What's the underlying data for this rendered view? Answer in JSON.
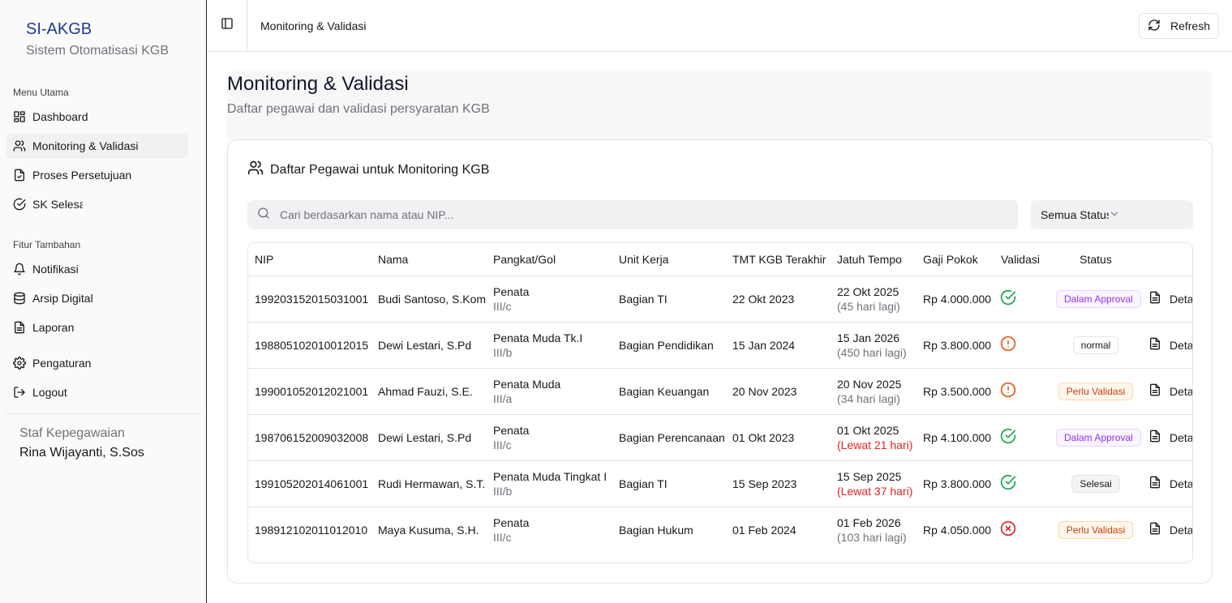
{
  "brand": {
    "title": "SI-AKGB",
    "subtitle": "Sistem Otomatisasi KGB"
  },
  "sidebar": {
    "group1_label": "Menu Utama",
    "group1": [
      {
        "label": "Dashboard",
        "icon": "dashboard-icon"
      },
      {
        "label": "Monitoring & Validasi",
        "icon": "users-icon",
        "active": true
      },
      {
        "label": "Proses Persetujuan",
        "icon": "file-check-icon"
      },
      {
        "label": "SK Selesai",
        "icon": "check-circle-icon"
      }
    ],
    "group2_label": "Fitur Tambahan",
    "group2": [
      {
        "label": "Notifikasi",
        "icon": "bell-icon"
      },
      {
        "label": "Arsip Digital",
        "icon": "database-icon"
      },
      {
        "label": "Laporan",
        "icon": "file-text-icon"
      }
    ],
    "group3": [
      {
        "label": "Pengaturan",
        "icon": "gear-icon"
      },
      {
        "label": "Logout",
        "icon": "logout-icon"
      }
    ],
    "user_role": "Staf Kepegawaian",
    "user_name": "Rina Wijayanti, S.Sos"
  },
  "topbar": {
    "title": "Monitoring & Validasi",
    "refresh_label": "Refresh"
  },
  "page": {
    "title": "Monitoring & Validasi",
    "subtitle": "Daftar pegawai dan validasi persyaratan KGB"
  },
  "card": {
    "title": "Daftar Pegawai untuk Monitoring KGB",
    "search_placeholder": "Cari berdasarkan nama atau NIP...",
    "filter_value": "Semua Status"
  },
  "table": {
    "columns": [
      "NIP",
      "Nama",
      "Pangkat/Gol",
      "Unit Kerja",
      "TMT KGB Terakhir",
      "Jatuh Tempo",
      "Gaji Pokok",
      "Validasi",
      "Status"
    ],
    "detail_label": "Detail",
    "rows": [
      {
        "nip": "199203152015031001",
        "nama": "Budi Santoso, S.Kom",
        "pangkat": "Penata",
        "gol": "III/c",
        "unit": "Bagian TI",
        "tmt": "22 Okt 2023",
        "jatuh": "22 Okt 2025",
        "sisa": "(45 hari lagi)",
        "late": false,
        "gaji": "Rp 4.000.000",
        "validasi": "valid",
        "status": "Dalam Approval"
      },
      {
        "nip": "198805102010012015",
        "nama": "Dewi Lestari, S.Pd",
        "pangkat": "Penata Muda Tk.I",
        "gol": "III/b",
        "unit": "Bagian Pendidikan",
        "tmt": "15 Jan 2024",
        "jatuh": "15 Jan 2026",
        "sisa": "(450 hari lagi)",
        "late": false,
        "gaji": "Rp 3.800.000",
        "validasi": "warning",
        "status": "normal"
      },
      {
        "nip": "199001052012021001",
        "nama": "Ahmad Fauzi, S.E.",
        "pangkat": "Penata Muda",
        "gol": "III/a",
        "unit": "Bagian Keuangan",
        "tmt": "20 Nov 2023",
        "jatuh": "20 Nov 2025",
        "sisa": "(34 hari lagi)",
        "late": false,
        "gaji": "Rp 3.500.000",
        "validasi": "warning",
        "status": "Perlu Validasi"
      },
      {
        "nip": "198706152009032008",
        "nama": "Dewi Lestari, S.Pd",
        "pangkat": "Penata",
        "gol": "III/c",
        "unit": "Bagian Perencanaan",
        "tmt": "01 Okt 2023",
        "jatuh": "01 Okt 2025",
        "sisa": "(Lewat 21 hari)",
        "late": true,
        "gaji": "Rp 4.100.000",
        "validasi": "valid",
        "status": "Dalam Approval"
      },
      {
        "nip": "199105202014061001",
        "nama": "Rudi Hermawan, S.T.",
        "pangkat": "Penata Muda Tingkat I",
        "gol": "III/b",
        "unit": "Bagian TI",
        "tmt": "15 Sep 2023",
        "jatuh": "15 Sep 2025",
        "sisa": "(Lewat 37 hari)",
        "late": true,
        "gaji": "Rp 3.800.000",
        "validasi": "valid",
        "status": "Selesai"
      },
      {
        "nip": "198912102011012010",
        "nama": "Maya Kusuma, S.H.",
        "pangkat": "Penata",
        "gol": "III/c",
        "unit": "Bagian Hukum",
        "tmt": "01 Feb 2024",
        "jatuh": "01 Feb 2026",
        "sisa": "(103 hari lagi)",
        "late": false,
        "gaji": "Rp 4.050.000",
        "validasi": "invalid",
        "status": "Perlu Validasi"
      }
    ]
  },
  "colors": {
    "brand": "#1e3a8a",
    "valid": "#16a34a",
    "warning": "#ea580c",
    "invalid": "#dc2626",
    "approval_text": "#9333ea",
    "approval_bg": "#faf5ff",
    "approval_border": "#e9d5ff",
    "perlu_text": "#c2410c",
    "perlu_bg": "#fff7ed",
    "perlu_border": "#fed7aa",
    "neutral_text": "#18181b",
    "neutral_bg": "#ffffff",
    "neutral_border": "#e4e4e7",
    "selesai_bg": "#f4f4f5"
  }
}
